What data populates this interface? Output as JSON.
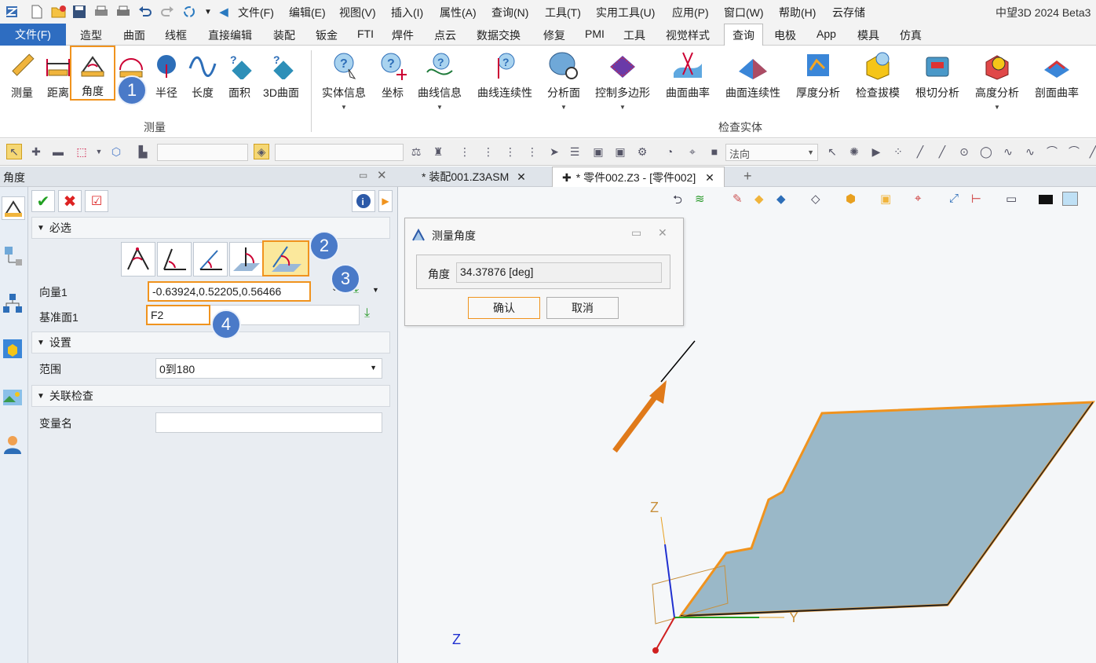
{
  "titlebar": {
    "menus": [
      "文件(F)",
      "编辑(E)",
      "视图(V)",
      "插入(I)",
      "属性(A)",
      "查询(N)",
      "工具(T)",
      "实用工具(U)",
      "应用(P)",
      "窗口(W)",
      "帮助(H)",
      "云存储"
    ],
    "app_title": "中望3D 2024 Beta3"
  },
  "ribbon_tabs": {
    "file": "文件(F)",
    "tabs": [
      "造型",
      "曲面",
      "线框",
      "直接编辑",
      "装配",
      "钣金",
      "FTI",
      "焊件",
      "点云",
      "数据交换",
      "修复",
      "PMI",
      "工具",
      "视觉样式",
      "查询",
      "电极",
      "App",
      "模具",
      "仿真"
    ],
    "active": "查询"
  },
  "ribbon": {
    "measure_group": {
      "label": "测量",
      "buttons": [
        "测量",
        "距离",
        "角度",
        "半径",
        "长度",
        "面积",
        "3D曲面"
      ]
    },
    "inspect_group": {
      "label": "检查实体",
      "buttons": [
        "实体信息",
        "坐标",
        "曲线信息",
        "曲线连续性",
        "分析面",
        "控制多边形",
        "曲面曲率",
        "曲面连续性",
        "厚度分析",
        "检查拔模",
        "根切分析",
        "高度分析",
        "剖面曲率"
      ]
    }
  },
  "toolbar2": {
    "normal_combo": "法向"
  },
  "panel": {
    "title": "角度",
    "sections": {
      "required": "必选",
      "settings": "设置",
      "assoc": "关联检查"
    },
    "vector_label": "向量1",
    "vector_value": "-0.63924,0.52205,0.56466",
    "base_label": "基准面1",
    "base_value": "F2",
    "range_label": "范围",
    "range_value": "0到180",
    "varname_label": "变量名",
    "varname_value": ""
  },
  "badges": [
    "1",
    "2",
    "3",
    "4"
  ],
  "doc_tabs": [
    "* 装配001.Z3ASM",
    "* 零件002.Z3 - [零件002]"
  ],
  "dialog": {
    "title": "测量角度",
    "angle_label": "角度",
    "angle_value": "34.37876  [deg]",
    "ok": "确认",
    "cancel": "取消"
  },
  "axes": {
    "z": "Z",
    "y": "Y",
    "z2": "Z"
  },
  "colors": {
    "accent": "#2e6dc1",
    "highlight": "#f0931e",
    "badge": "#4a7ac8",
    "plane_fill": "#9ab8c8"
  }
}
